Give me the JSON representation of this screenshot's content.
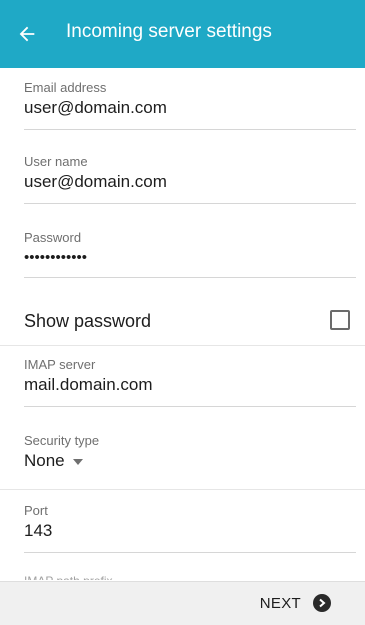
{
  "appbar": {
    "title": "Incoming server settings",
    "back_icon": "arrow-left-icon",
    "color": "#1fa9c6"
  },
  "fields": {
    "email": {
      "label": "Email address",
      "value": "user@domain.com"
    },
    "username": {
      "label": "User name",
      "value": "user@domain.com"
    },
    "password": {
      "label": "Password",
      "value": "••••••••••••"
    },
    "show_password": {
      "label": "Show password",
      "checked": false
    },
    "imap_server": {
      "label": "IMAP server",
      "value": "mail.domain.com"
    },
    "security_type": {
      "label": "Security type",
      "value": "None"
    },
    "port": {
      "label": "Port",
      "value": "143"
    },
    "cut_label": {
      "label": "IMAP path prefix"
    }
  },
  "footer": {
    "next_label": "NEXT",
    "next_icon": "chevron-right-circle-icon"
  }
}
